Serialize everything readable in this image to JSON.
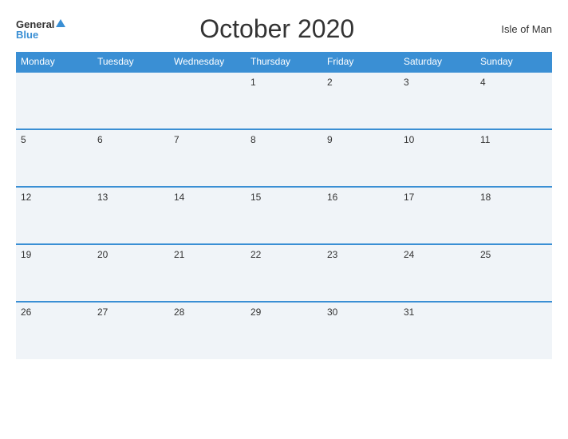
{
  "header": {
    "logo_general": "General",
    "logo_blue": "Blue",
    "title": "October 2020",
    "region": "Isle of Man"
  },
  "calendar": {
    "days_of_week": [
      "Monday",
      "Tuesday",
      "Wednesday",
      "Thursday",
      "Friday",
      "Saturday",
      "Sunday"
    ],
    "weeks": [
      [
        "",
        "",
        "",
        "1",
        "2",
        "3",
        "4"
      ],
      [
        "5",
        "6",
        "7",
        "8",
        "9",
        "10",
        "11"
      ],
      [
        "12",
        "13",
        "14",
        "15",
        "16",
        "17",
        "18"
      ],
      [
        "19",
        "20",
        "21",
        "22",
        "23",
        "24",
        "25"
      ],
      [
        "26",
        "27",
        "28",
        "29",
        "30",
        "31",
        ""
      ]
    ]
  }
}
